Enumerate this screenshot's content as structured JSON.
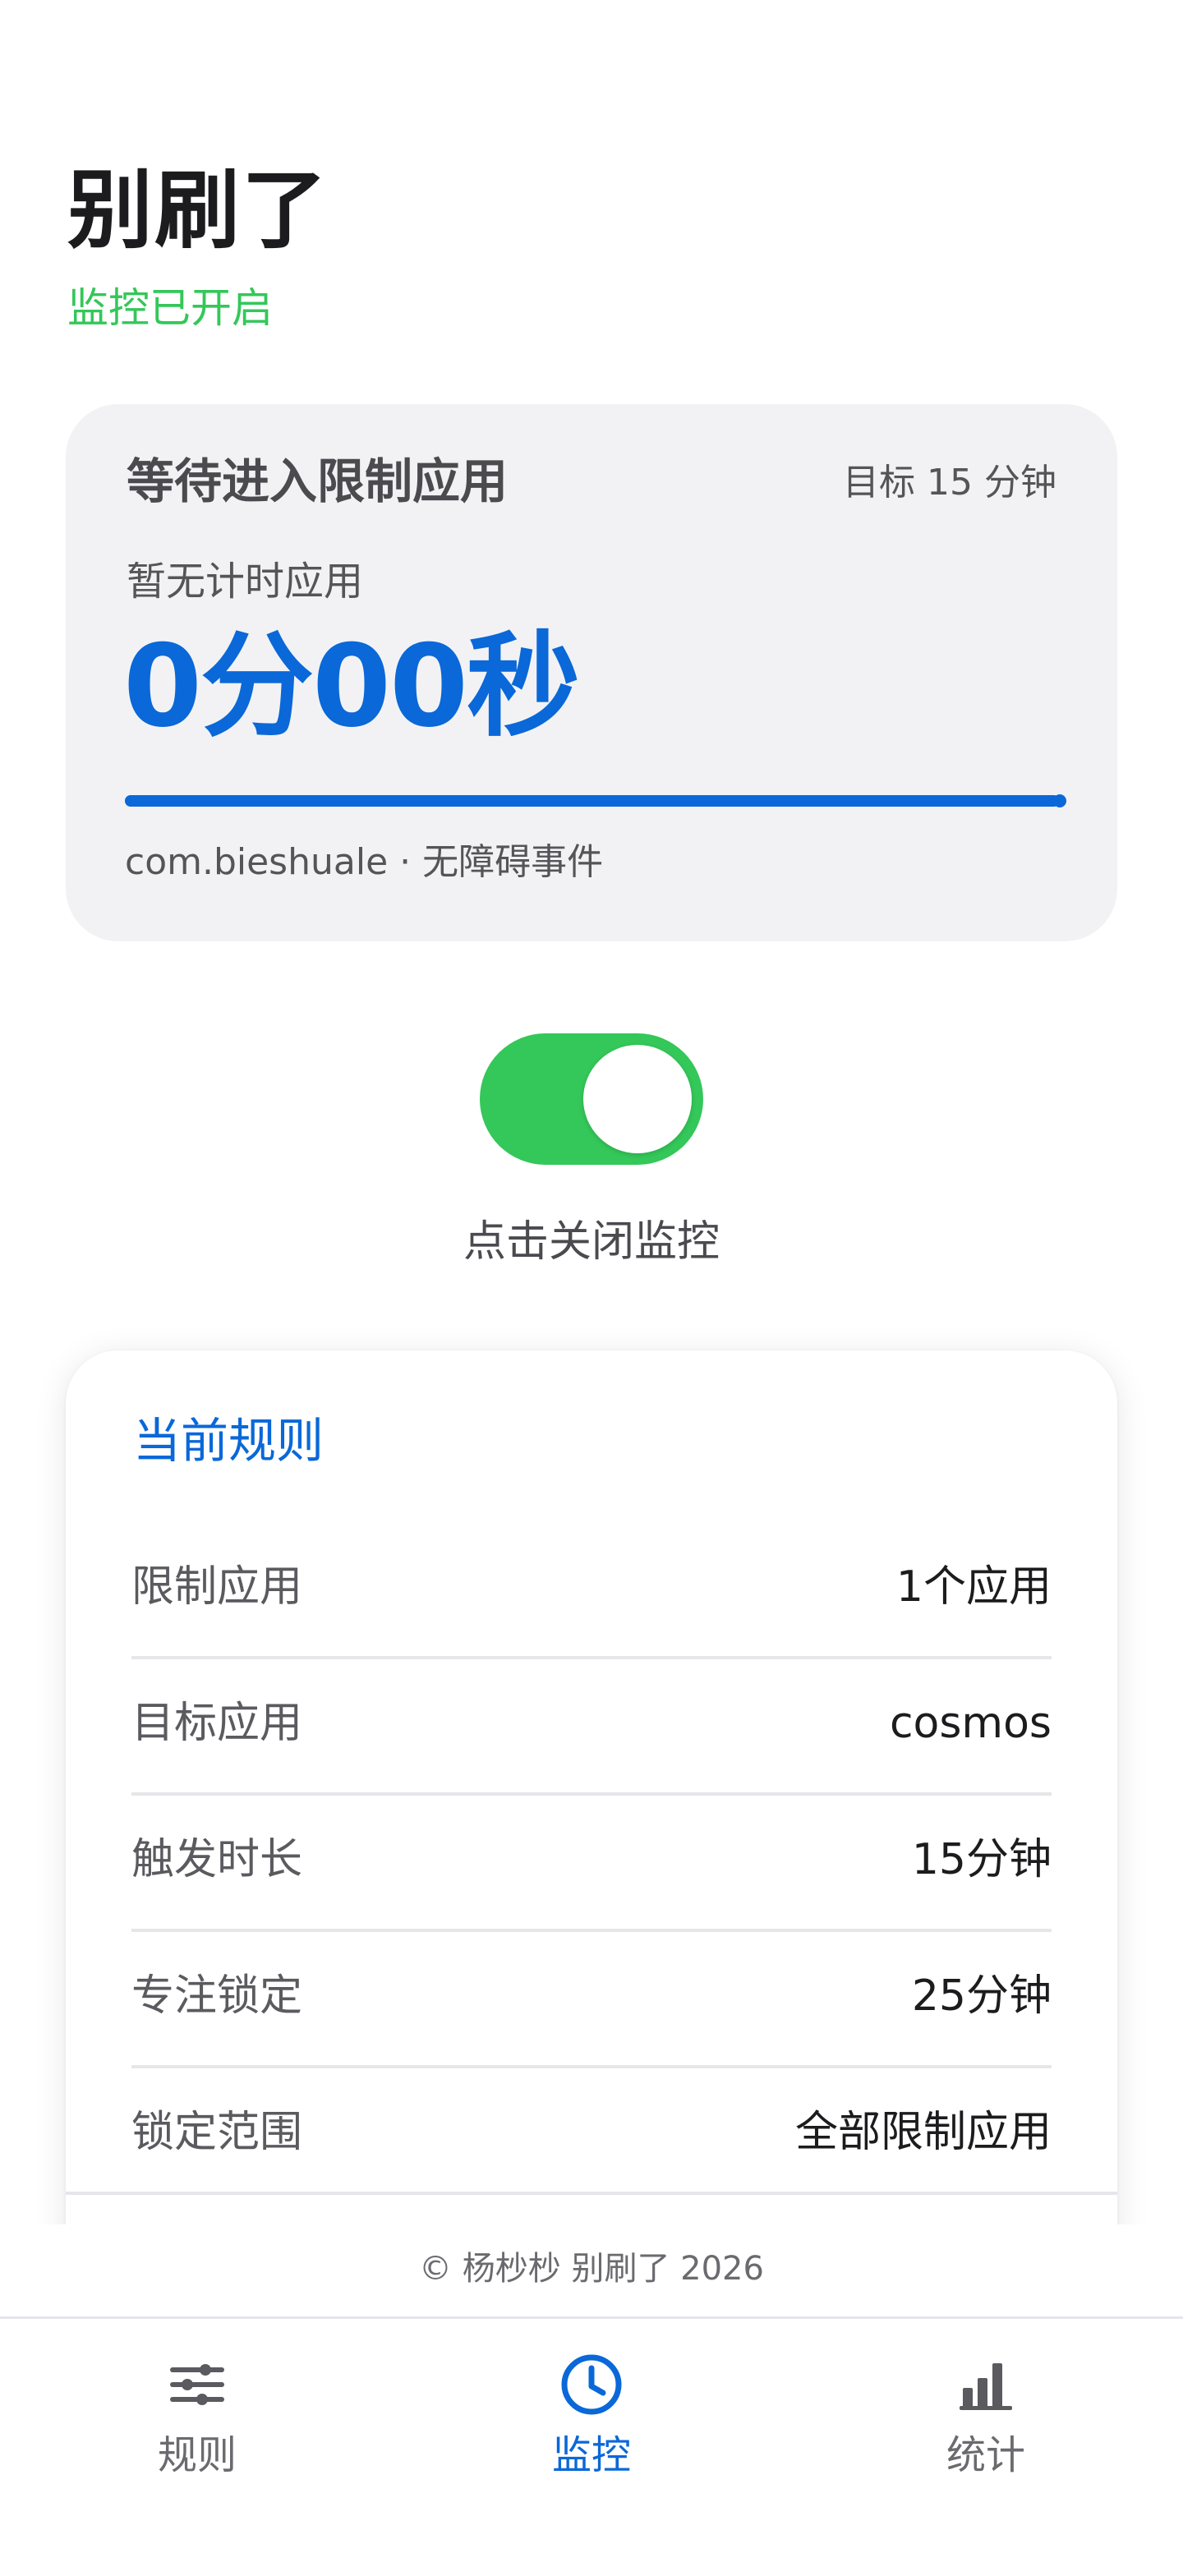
{
  "header": {
    "title": "别刷了",
    "status": "监控已开启"
  },
  "timer_card": {
    "waiting_label": "等待进入限制应用",
    "target_label": "目标 15 分钟",
    "no_app_label": "暂无计时应用",
    "timer_value": "0分00秒",
    "progress_fraction": 1.0,
    "source_label": "com.bieshuale · 无障碍事件"
  },
  "toggle": {
    "state": "on",
    "caption": "点击关闭监控"
  },
  "rules": {
    "title": "当前规则",
    "items": [
      {
        "label": "限制应用",
        "value": "1个应用"
      },
      {
        "label": "目标应用",
        "value": "cosmos"
      },
      {
        "label": "触发时长",
        "value": "15分钟"
      },
      {
        "label": "专注锁定",
        "value": "25分钟"
      },
      {
        "label": "锁定范围",
        "value": "全部限制应用"
      }
    ]
  },
  "footer": {
    "copyright": "© 杨杪杪 别刷了 2026"
  },
  "nav": {
    "active": "monitor",
    "items": [
      {
        "id": "rules",
        "label": "规则",
        "icon": "sliders-icon"
      },
      {
        "id": "monitor",
        "label": "监控",
        "icon": "clock-icon"
      },
      {
        "id": "stats",
        "label": "统计",
        "icon": "bar-chart-icon"
      }
    ]
  },
  "colors": {
    "accent": "#0a68d8",
    "success": "#34c759",
    "card_bg": "#f2f2f5"
  }
}
